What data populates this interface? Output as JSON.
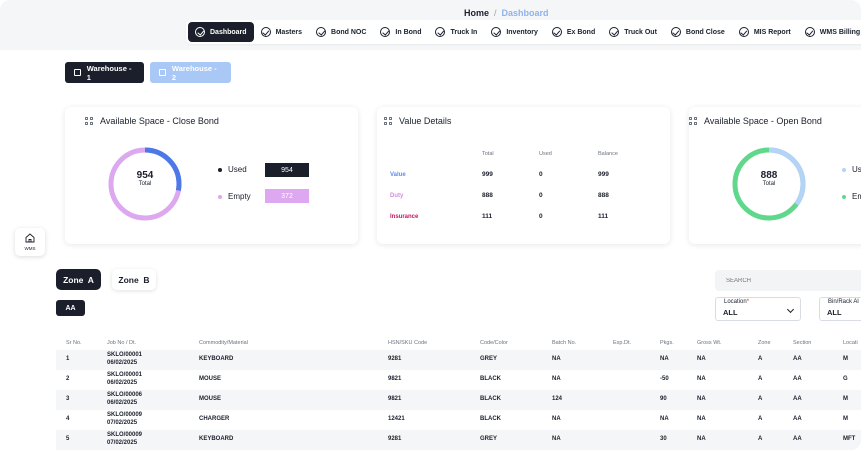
{
  "breadcrumb": {
    "home": "Home",
    "separator": "/",
    "current": "Dashboard"
  },
  "nav": [
    {
      "label": "Dashboard",
      "active": true
    },
    {
      "label": "Masters"
    },
    {
      "label": "Bond NOC"
    },
    {
      "label": "In Bond"
    },
    {
      "label": "Truck In"
    },
    {
      "label": "Inventory"
    },
    {
      "label": "Ex Bond"
    },
    {
      "label": "Truck Out"
    },
    {
      "label": "Bond Close"
    },
    {
      "label": "MIS Report"
    },
    {
      "label": "WMS Billing"
    }
  ],
  "warehouses": [
    "Warehouse - 1",
    "Warehouse - 2"
  ],
  "close_bond": {
    "title": "Available Space - Close Bond",
    "total": "954",
    "total_label": "Total",
    "used_label": "Used",
    "used_value": "954",
    "empty_label": "Empty",
    "empty_value": "372",
    "used_fraction": 0.28
  },
  "value_details": {
    "title": "Value Details",
    "headers": [
      "Total",
      "Used",
      "Balance"
    ],
    "rows": [
      {
        "label": "Value",
        "total": "999",
        "used": "0",
        "balance": "999",
        "color": "#5b8def"
      },
      {
        "label": "Duty",
        "total": "888",
        "used": "0",
        "balance": "888",
        "color": "#d48ae6"
      },
      {
        "label": "Insurance",
        "total": "111",
        "used": "0",
        "balance": "111",
        "color": "#c2185b"
      }
    ]
  },
  "open_bond": {
    "title": "Available Space - Open Bond",
    "total": "888",
    "total_label": "Total",
    "used_label": "Use",
    "empty_label": "Em",
    "used_fraction": 0.35
  },
  "colors": {
    "dark": "#1a1f2b",
    "blue": "#4c79e6",
    "pink": "#dda8ef",
    "lightblue": "#b5d3f7",
    "green": "#5fd88c"
  },
  "wms": {
    "label": "WMS",
    "icon": "home-icon"
  },
  "zones": [
    "Zone  A",
    "Zone  B"
  ],
  "aa_tag": "AA",
  "search": {
    "placeholder": "SEARCH"
  },
  "filters": {
    "location": {
      "label": "Location",
      "required": "*",
      "value": "ALL"
    },
    "bin": {
      "label": "Bin/Rack Al",
      "value": "ALL"
    }
  },
  "table": {
    "headers": [
      "Sr No.",
      "Job No / Dt.",
      "Commodity/Material",
      "HSN/SKU Code",
      "Code/Color",
      "Batch No.",
      "Exp.Dt.",
      "Pkgs.",
      "Gross Wt.",
      "Zone",
      "Section",
      "Locati"
    ],
    "rows": [
      [
        "1",
        "SKLO/00001",
        "06/02/2025",
        "KEYBOARD",
        "9281",
        "GREY",
        "NA",
        "",
        "NA",
        "NA",
        "A",
        "AA",
        "M"
      ],
      [
        "2",
        "SKLO/00001",
        "06/02/2025",
        "MOUSE",
        "9821",
        "BLACK",
        "NA",
        "",
        "-50",
        "NA",
        "A",
        "AA",
        "G"
      ],
      [
        "3",
        "SKLO/00006",
        "06/02/2025",
        "MOUSE",
        "9821",
        "BLACK",
        "124",
        "",
        "90",
        "NA",
        "A",
        "AA",
        "M"
      ],
      [
        "4",
        "SKLO/00009",
        "07/02/2025",
        "CHARGER",
        "12421",
        "BLACK",
        "NA",
        "",
        "NA",
        "NA",
        "A",
        "AA",
        "M"
      ],
      [
        "5",
        "SKLO/00009",
        "07/02/2025",
        "KEYBOARD",
        "9281",
        "GREY",
        "NA",
        "",
        "30",
        "NA",
        "A",
        "AA",
        "MFT"
      ]
    ]
  }
}
